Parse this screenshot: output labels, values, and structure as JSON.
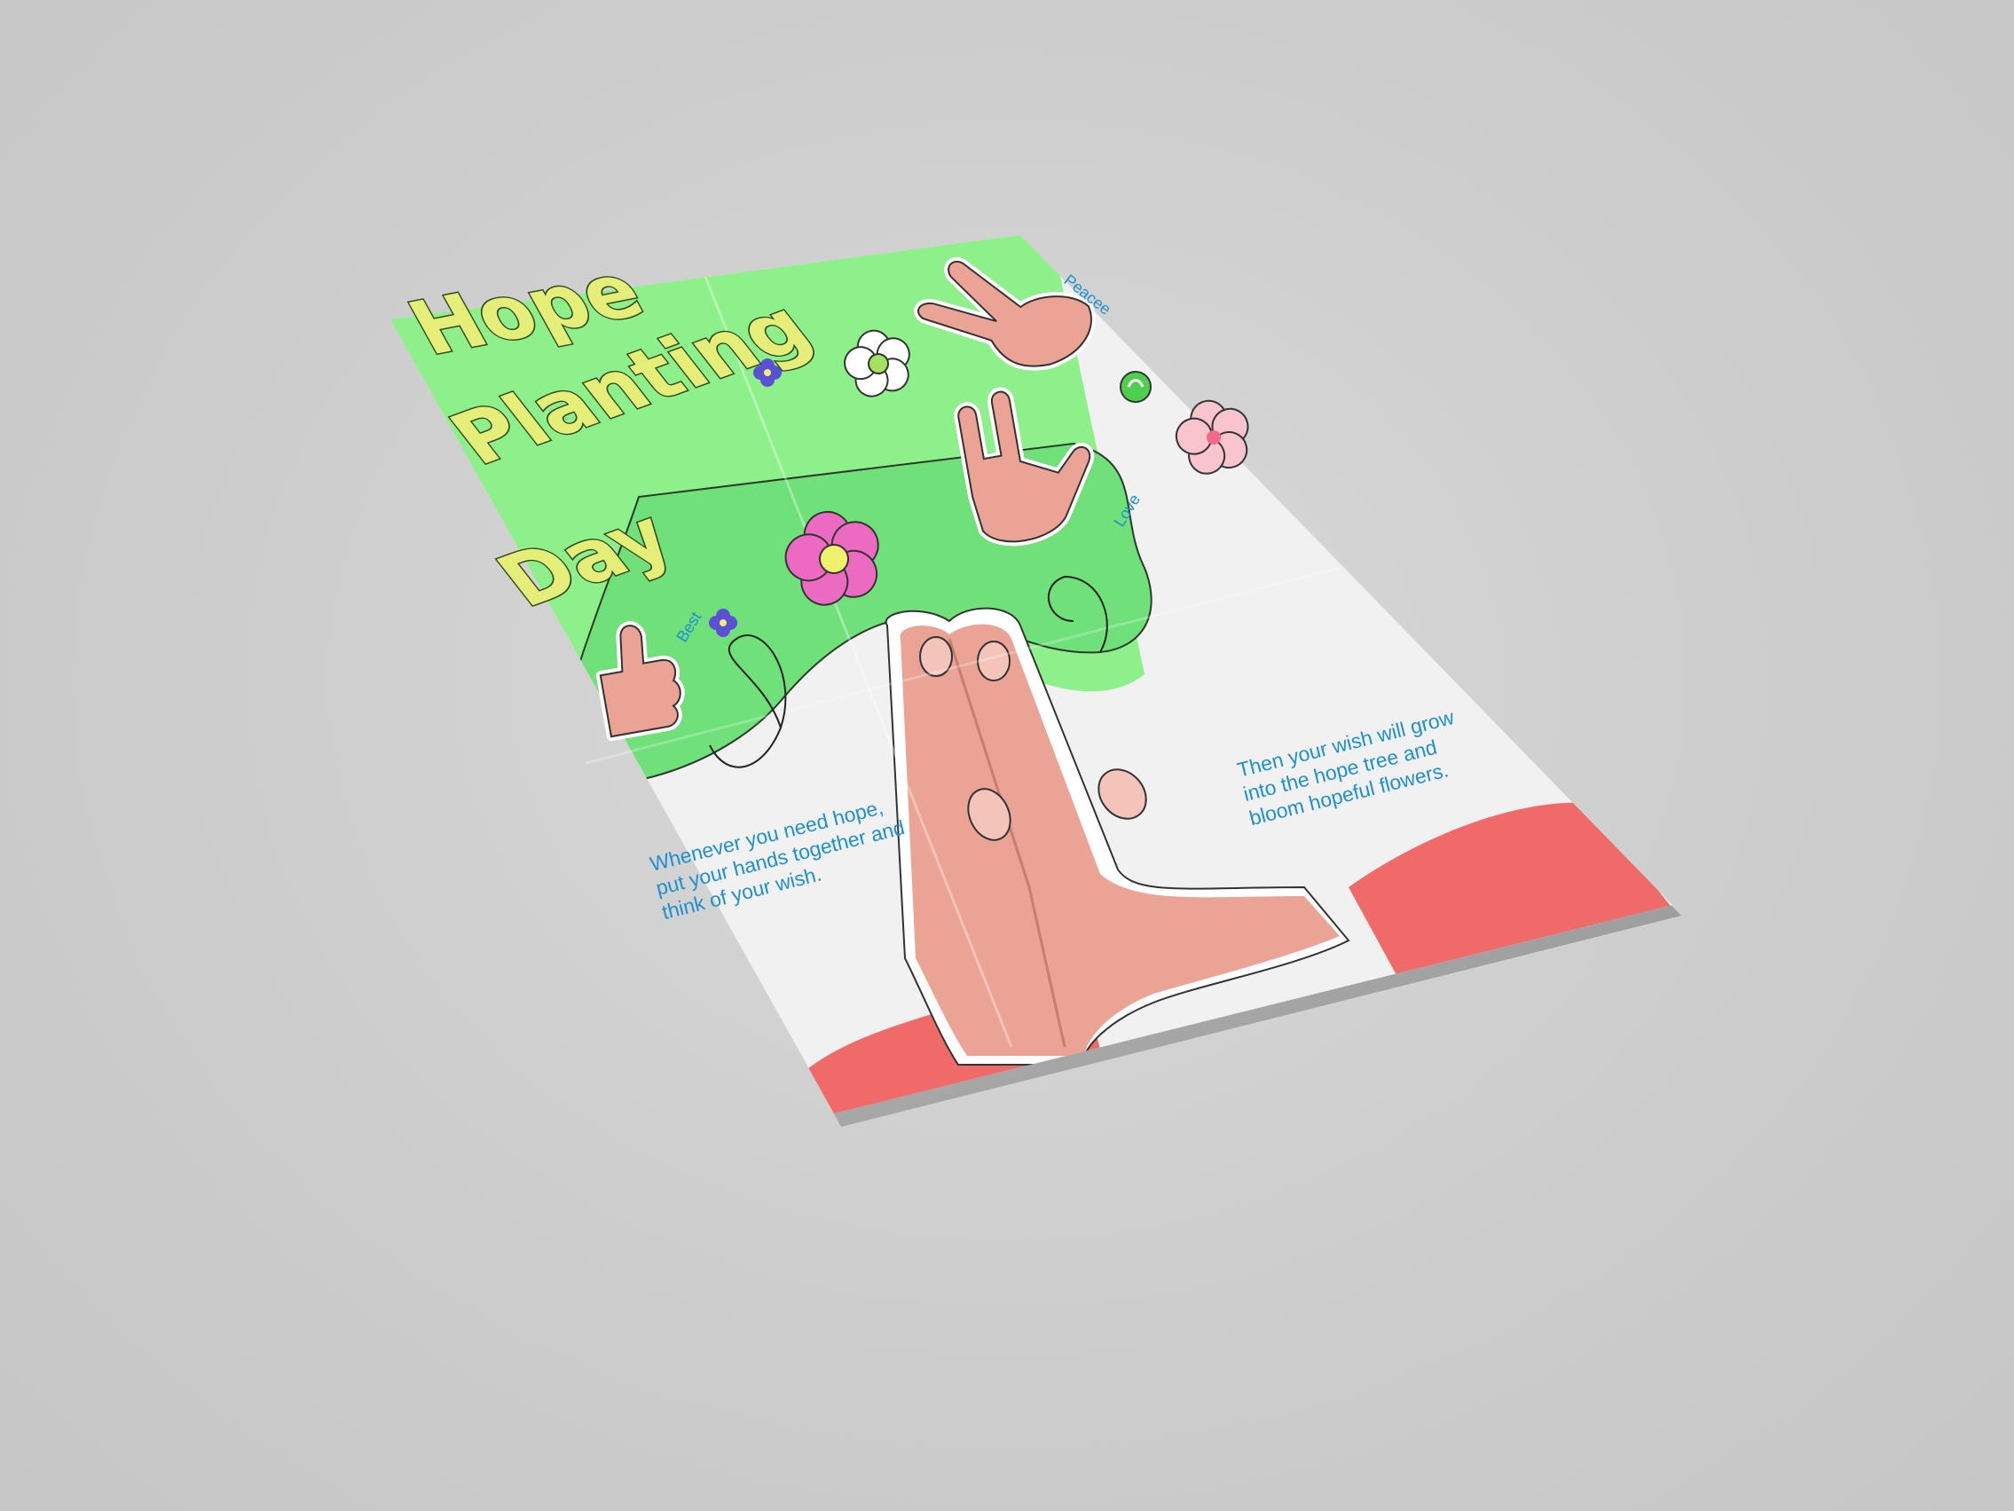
{
  "poster": {
    "title_lines": [
      "Hope",
      "Planting",
      "Day"
    ],
    "labels": {
      "peace": "Peacee",
      "love": "Love",
      "best": "Best"
    },
    "left_text": [
      "Whenever you need hope,",
      "put your hands together and",
      "think of your wish."
    ],
    "right_text": [
      "Then your wish will grow",
      "into the hope tree and",
      "bloom hopeful flowers."
    ]
  },
  "colors": {
    "background": "#cfcfcf",
    "poster_green": "#8ef08a",
    "tree_green": "#6fe07a",
    "paper": "#f1f1f1",
    "sleeve_red": "#f16a6a",
    "skin": "#eaa394",
    "title_yellow": "#e6ee7a",
    "text_blue": "#1e8fcf"
  },
  "icons": [
    "peace-hand-icon",
    "love-hand-icon",
    "thumbs-up-icon",
    "praying-hands-icon",
    "flower-icon"
  ]
}
